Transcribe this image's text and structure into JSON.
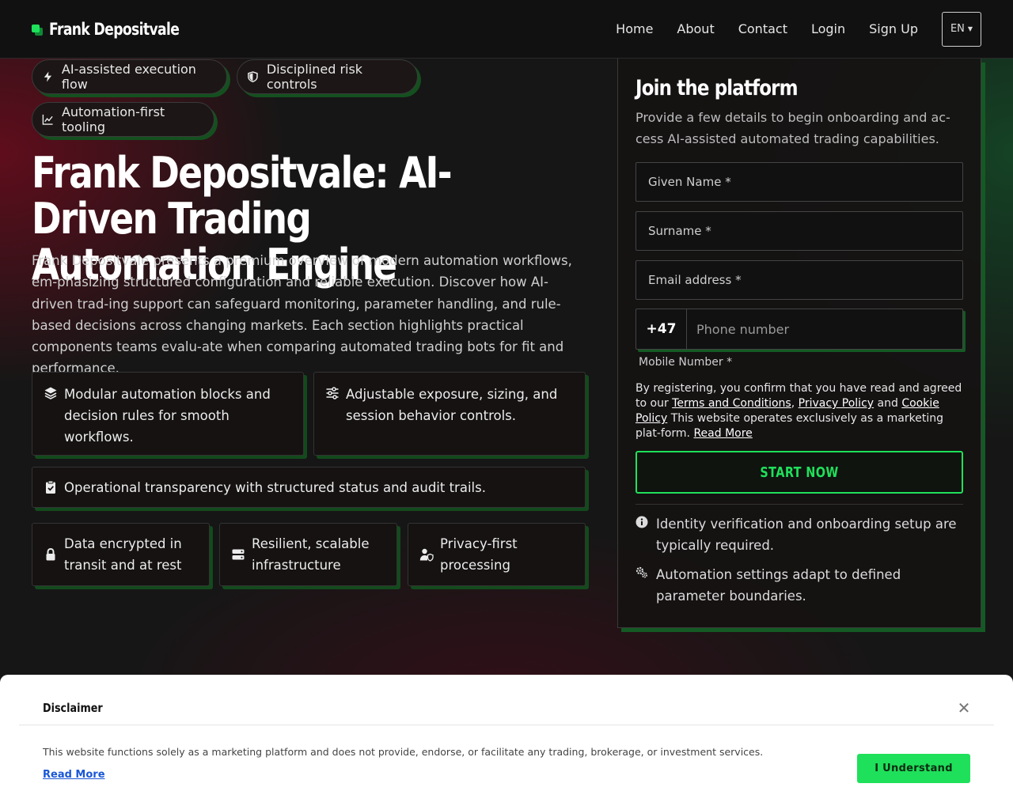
{
  "brand": {
    "name": "Frank Depositvale"
  },
  "nav": {
    "items": [
      "Home",
      "About",
      "Contact",
      "Login",
      "Sign Up"
    ],
    "language": "EN"
  },
  "chips": [
    {
      "label": "AI-assisted execution flow",
      "icon": "bolt-icon"
    },
    {
      "label": "Disciplined risk controls",
      "icon": "shield-icon"
    },
    {
      "label": "Automation-first tooling",
      "icon": "line-chart-icon"
    }
  ],
  "hero": {
    "title": "Frank Depositvale: AI-Driven Trading Automation Engine",
    "description": "Frank Depositvale presents a premium overview of modern automation workflows, em-phasizing structured configuration and reliable execution. Discover how AI-driven trad-ing support can safeguard monitoring, parameter handling, and rule-based decisions across changing markets. Each section highlights practical components teams evalu-ate when comparing automated trading bots for fit and performance."
  },
  "features": [
    {
      "text": "Modular automation blocks and decision rules for smooth workflows.",
      "icon": "layers-icon"
    },
    {
      "text": "Adjustable exposure, sizing, and session behavior controls.",
      "icon": "sliders-icon"
    },
    {
      "text": "Operational transparency with structured status and audit trails.",
      "icon": "clipboard-check-icon"
    }
  ],
  "badges": [
    {
      "text": "Data encrypted in transit and at rest",
      "icon": "lock-icon"
    },
    {
      "text": "Resilient, scalable infrastructure",
      "icon": "server-icon"
    },
    {
      "text": "Privacy-first processing",
      "icon": "user-shield-icon"
    }
  ],
  "form": {
    "title": "Join the platform",
    "subtitle": "Provide a few details to begin onboarding and ac-cess AI-assisted automated trading capabilities.",
    "given_name": "Given Name *",
    "surname": "Surname *",
    "email": "Email address *",
    "phone_code": "+47",
    "phone_placeholder": "Phone number",
    "mobile_label": "Mobile Number *",
    "legal_prefix": "By registering, you confirm that you have read and agreed to our",
    "terms": "Terms and Conditions",
    "privacy": "Privacy Policy",
    "and": "and",
    "cookie": "Cookie Policy",
    "legal_suffix": "This website operates exclusively as a marketing plat-form.",
    "read_more": "Read More",
    "submit": "START NOW",
    "notes": [
      {
        "text": "Identity verification and onboarding setup are typically required.",
        "icon": "info-icon"
      },
      {
        "text": "Automation settings adapt to defined parameter boundaries.",
        "icon": "gears-icon"
      }
    ]
  },
  "disclaimer": {
    "title": "Disclaimer",
    "text": "This website functions solely as a marketing platform and does not provide, endorse, or facilitate any trading, brokerage, or investment services.",
    "read_more": "Read More",
    "button": "I Understand"
  },
  "colors": {
    "accent": "#1fe05a",
    "shadow": "#145a24",
    "link": "#1a56d6"
  }
}
